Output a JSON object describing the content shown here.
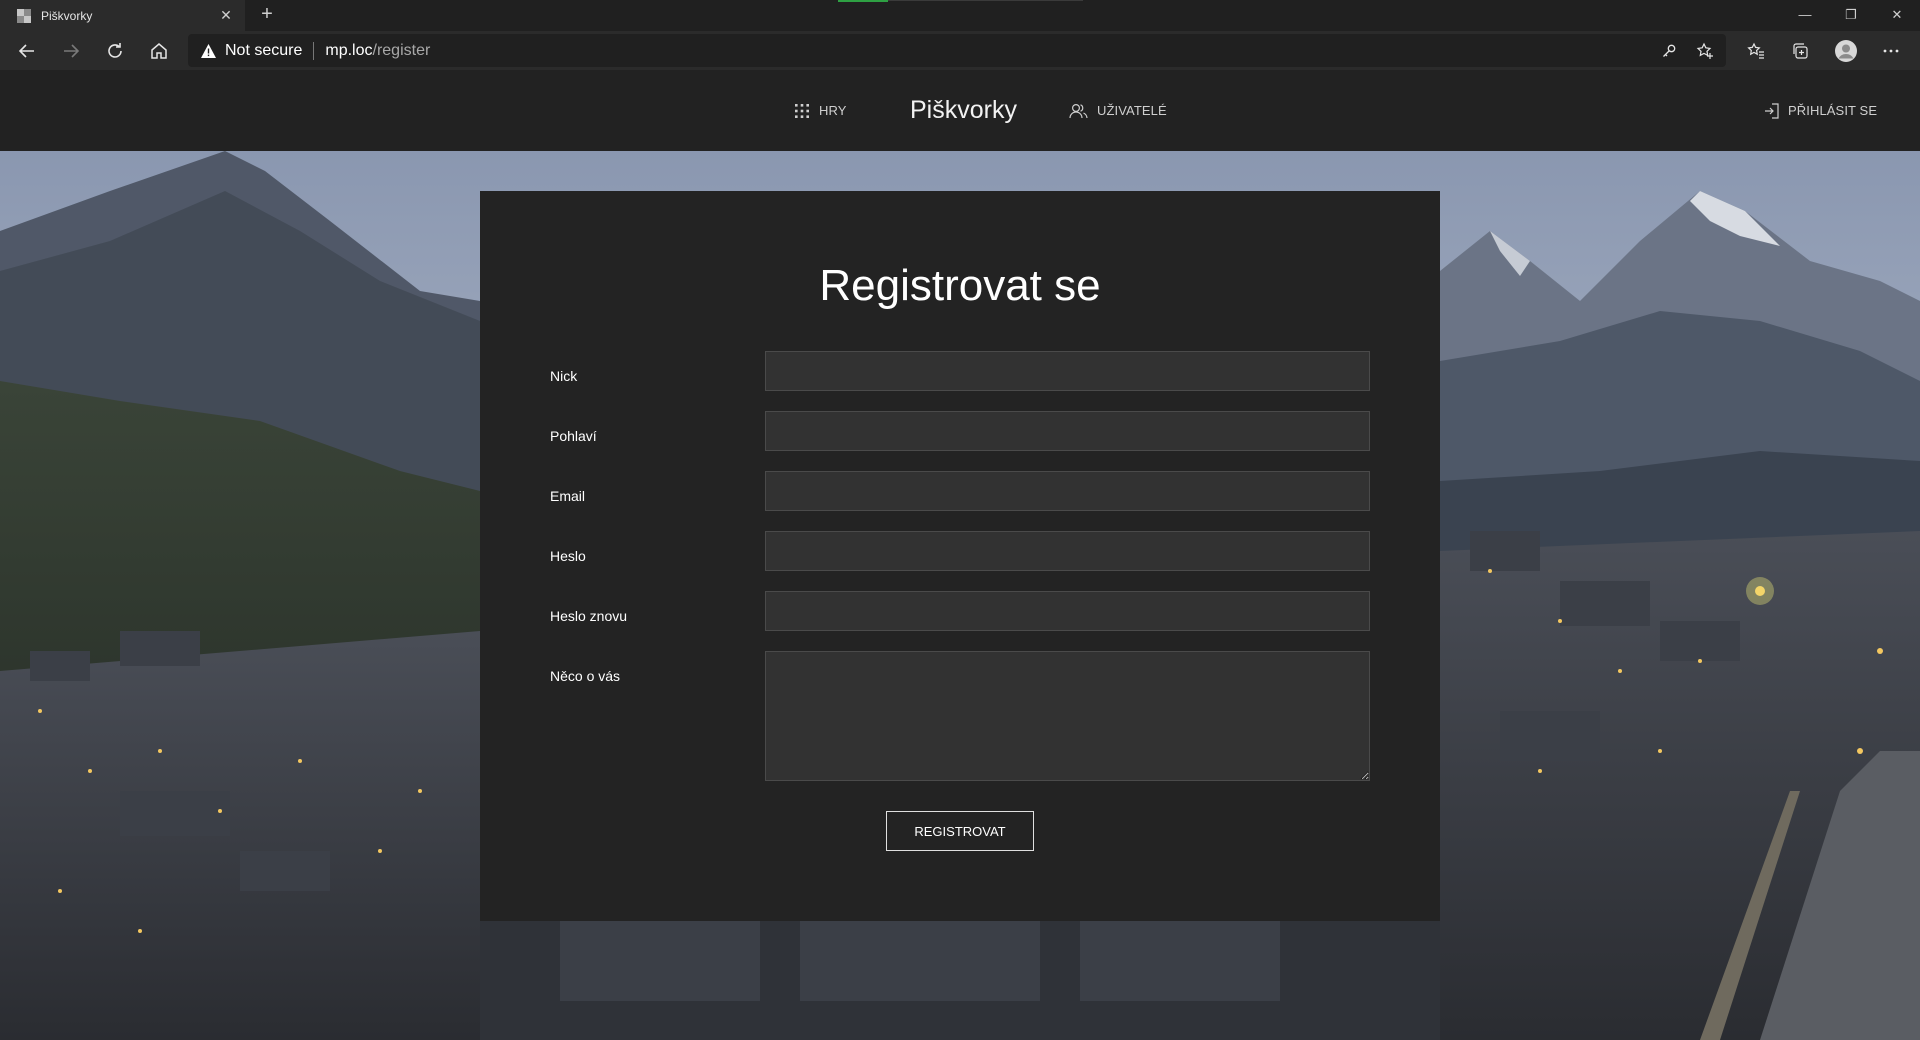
{
  "browser": {
    "tab": {
      "title": "Piškvorky"
    },
    "address": {
      "security_label": "Not secure",
      "host": "mp.loc",
      "path": "/register"
    }
  },
  "header": {
    "menu_left": {
      "games_label": "HRY",
      "users_label": "UŽIVATELÉ"
    },
    "brand": "Piškvorky",
    "login_label": "PŘIHLÁSIT SE"
  },
  "form": {
    "title": "Registrovat se",
    "fields": [
      {
        "label": "Nick",
        "value": ""
      },
      {
        "label": "Pohlaví",
        "value": ""
      },
      {
        "label": "Email",
        "value": ""
      },
      {
        "label": "Heslo",
        "value": ""
      },
      {
        "label": "Heslo znovu",
        "value": ""
      },
      {
        "label": "Něco o vás",
        "value": ""
      }
    ],
    "submit_label": "REGISTROVAT"
  },
  "colors": {
    "header_bg": "#222222",
    "card_bg": "#232323",
    "input_bg": "#323232",
    "loading_accent": "#2ea043"
  },
  "icons": {
    "games": "grid-dots-icon",
    "users": "users-icon",
    "login": "sign-in-icon"
  }
}
